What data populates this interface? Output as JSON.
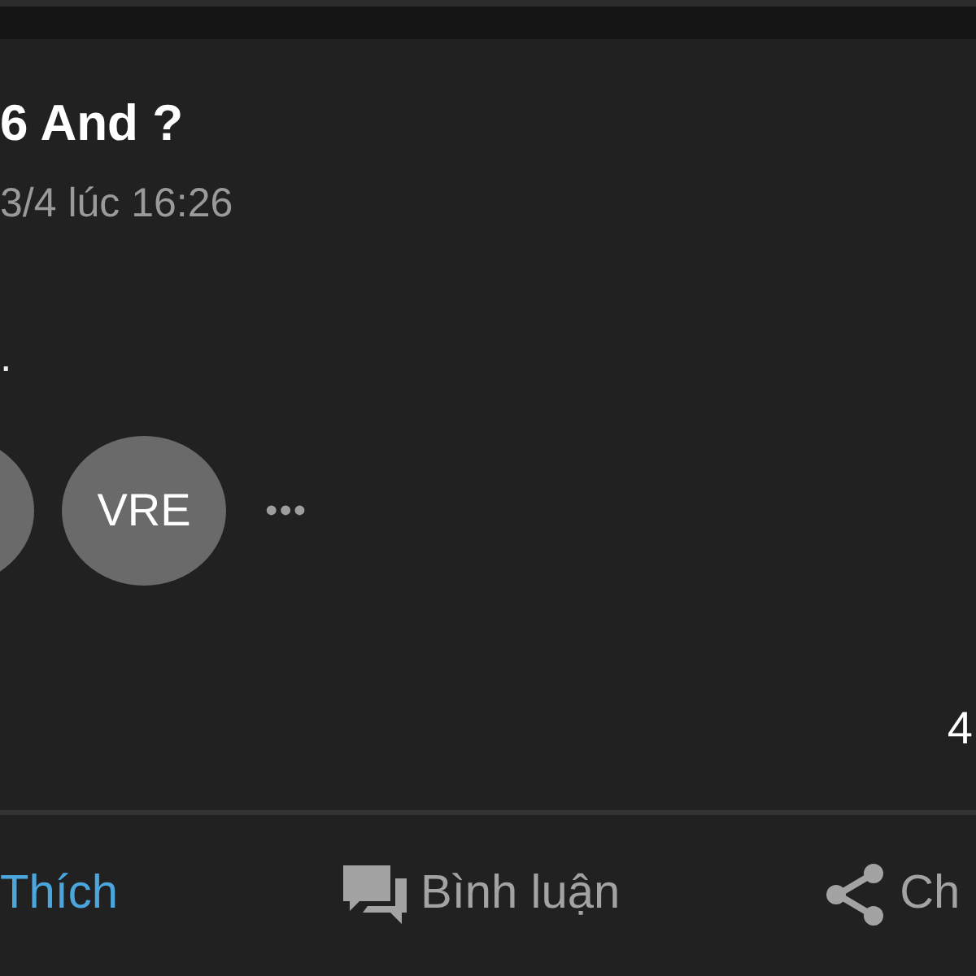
{
  "post": {
    "title": "6 And ?",
    "timestamp": "3/4 lúc 16:26",
    "body": "."
  },
  "tags": [
    {
      "kind": "chip"
    },
    {
      "kind": "chip",
      "label": "VRE"
    }
  ],
  "more": "•••",
  "count": "4",
  "actions": [
    {
      "kind": "like",
      "label": "Thích",
      "liked": true
    },
    {
      "kind": "comment",
      "label": "Bình luận"
    },
    {
      "kind": "share",
      "label": "Ch"
    }
  ]
}
